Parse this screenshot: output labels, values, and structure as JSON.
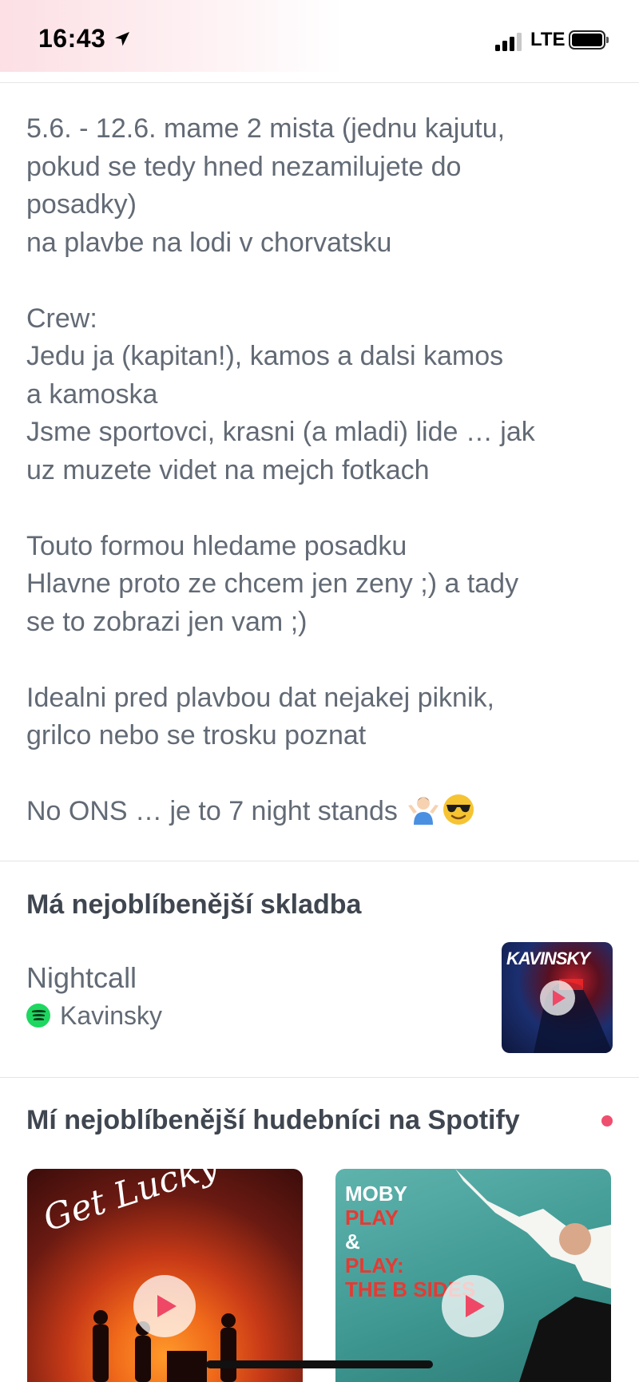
{
  "status_bar": {
    "time": "16:43",
    "network": "LTE"
  },
  "bio": {
    "text": "5.6. - 12.6. mame 2 mista (jednu kajutu,\npokud se tedy hned nezamilujete do\nposadky)\nna plavbe na lodi v chorvatsku\n\nCrew:\nJedu ja (kapitan!), kamos a dalsi kamos\na kamoska\nJsme sportovci, krasni (a mladi) lide … jak\nuz muzete videt na mejch fotkach\n\nTouto formou hledame posadku\nHlavne proto ze chcem jen zeny ;) a tady\nse to zobrazi jen vam ;)\n\nIdealni pred plavbou dat nejakej piknik,\ngrilco nebo se trosku poznat\n\nNo ONS … je to 7 night stands ",
    "emojis": [
      "person-shrugging-emoji",
      "sunglasses-face-emoji"
    ]
  },
  "anthem": {
    "section_title": "Má nejoblíbenější skladba",
    "song_title": "Nightcall",
    "artist": "Kavinsky",
    "cover_text": "KAVINSKY"
  },
  "top_artists": {
    "section_title": "Mí nejoblíbenější hudebníci na Spotify",
    "cards": [
      {
        "cover_text": "Get Lucky"
      },
      {
        "cover_lines": [
          "MOBY",
          "PLAY",
          "&",
          "PLAY:",
          "THE B SIDES"
        ]
      }
    ]
  },
  "colors": {
    "accent": "#ee4866",
    "spotify": "#1ed760",
    "text": "#626a75"
  }
}
